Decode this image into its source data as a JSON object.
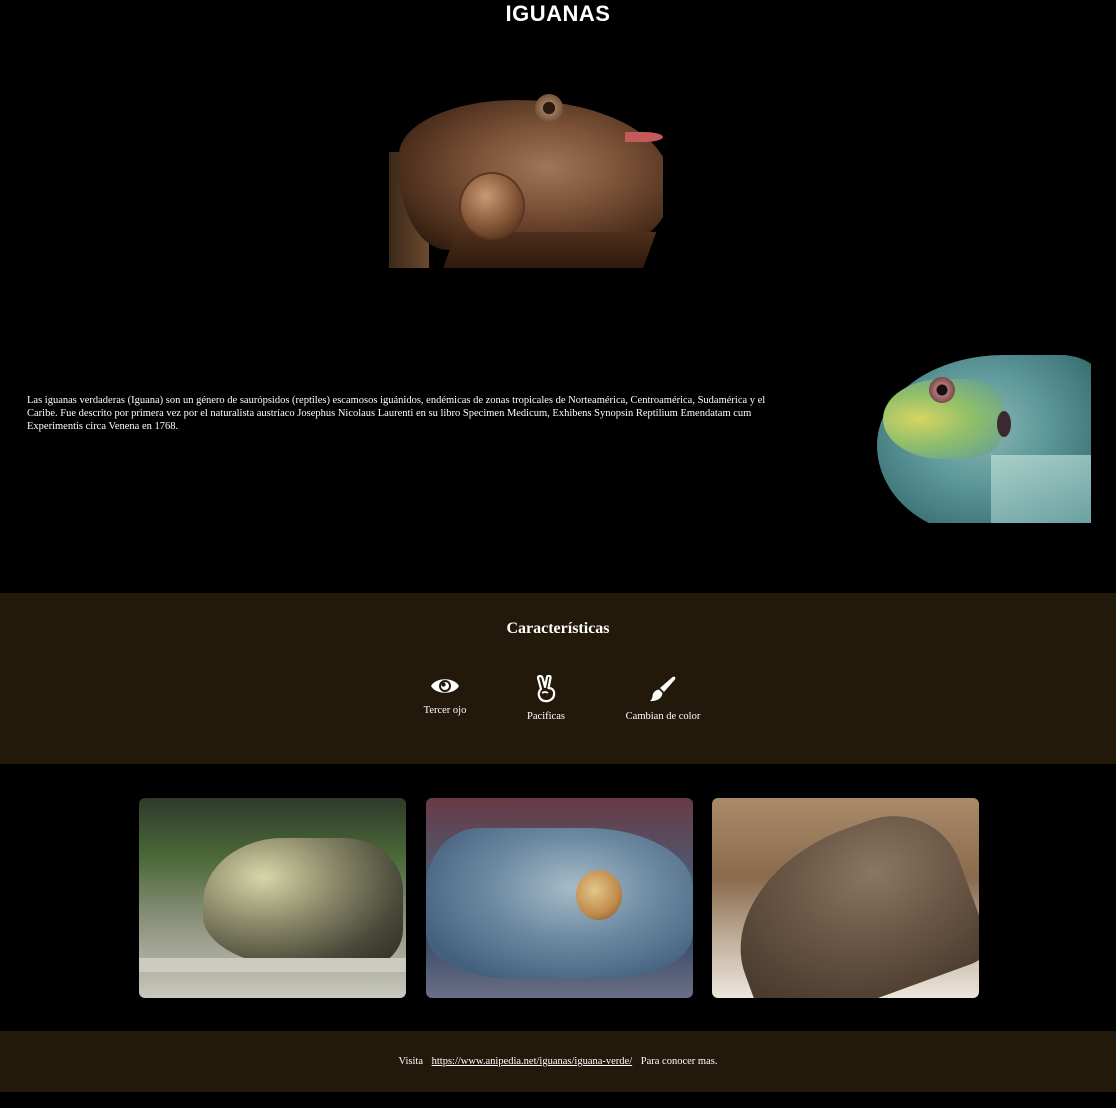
{
  "header": {
    "title": "IGUANAS"
  },
  "intro": {
    "text": "Las iguanas verdaderas (Iguana) son un género de saurópsidos (reptiles) escamosos iguánidos, endémicas de zonas tropicales de Norteamérica, Centroamérica, Sudamérica y el Caribe. Fue descrito por primera vez por el naturalista austríaco Josephus Nicolaus Laurenti en su libro Specimen Medicum, Exhibens Synopsin Reptilium Emendatam cum Experimentis circa Venena en 1768."
  },
  "features": {
    "title": "Características",
    "items": [
      {
        "icon": "eye-icon",
        "label": "Tercer ojo"
      },
      {
        "icon": "peace-hand-icon",
        "label": "Pacificas"
      },
      {
        "icon": "paintbrush-icon",
        "label": "Cambian de color"
      }
    ]
  },
  "footer": {
    "prefix": "Visita",
    "link": "https://www.anipedia.net/iguanas/iguana-verde/",
    "suffix": "Para conocer mas."
  },
  "colors": {
    "background": "#000000",
    "band": "#23190a",
    "text": "#ffffff"
  }
}
